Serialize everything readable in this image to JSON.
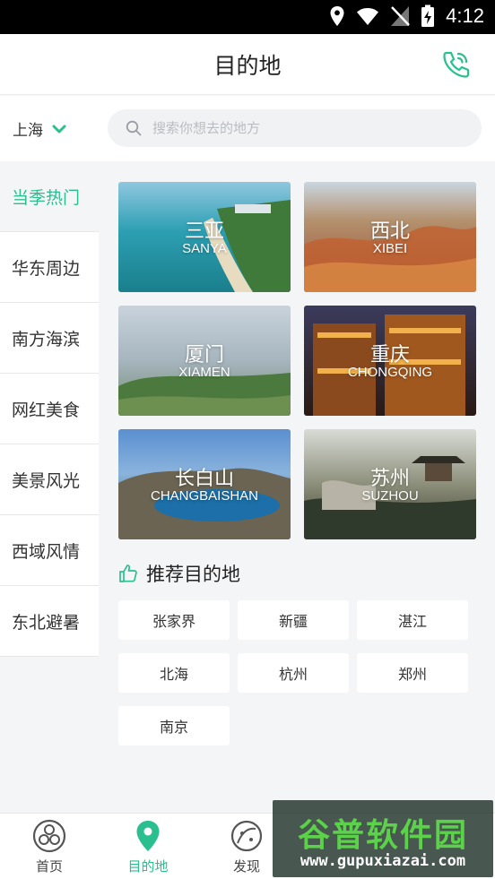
{
  "status_bar": {
    "time": "4:12"
  },
  "header": {
    "title": "目的地"
  },
  "search": {
    "city": "上海",
    "placeholder": "搜索你想去的地方"
  },
  "sidebar": {
    "items": [
      {
        "label": "当季热门"
      },
      {
        "label": "华东周边"
      },
      {
        "label": "南方海滨"
      },
      {
        "label": "网红美食"
      },
      {
        "label": "美景风光"
      },
      {
        "label": "西域风情"
      },
      {
        "label": "东北避暑"
      }
    ]
  },
  "destinations": [
    {
      "cn": "三亚",
      "en": "SANYA"
    },
    {
      "cn": "西北",
      "en": "XIBEI"
    },
    {
      "cn": "厦门",
      "en": "XIAMEN"
    },
    {
      "cn": "重庆",
      "en": "CHONGQING"
    },
    {
      "cn": "长白山",
      "en": "CHANGBAISHAN"
    },
    {
      "cn": "苏州",
      "en": "SUZHOU"
    }
  ],
  "recommend": {
    "title": "推荐目的地",
    "tags": [
      "张家界",
      "新疆",
      "湛江",
      "北海",
      "杭州",
      "郑州",
      "南京"
    ]
  },
  "tabbar": {
    "tabs": [
      {
        "label": "首页"
      },
      {
        "label": "目的地"
      },
      {
        "label": "发现"
      }
    ]
  },
  "watermark": {
    "title": "谷普软件园",
    "url": "www.gupuxiazai.com"
  },
  "colors": {
    "accent": "#2bbf8f",
    "background": "#f4f5f7"
  }
}
